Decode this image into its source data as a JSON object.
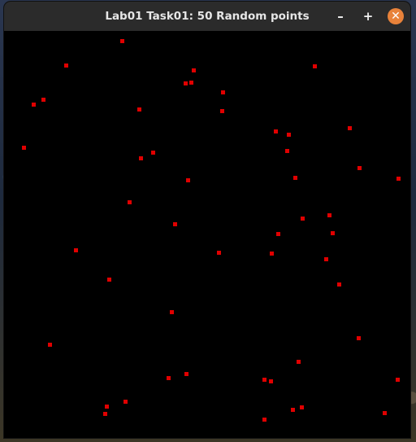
{
  "window": {
    "title": "Lab01 Task01: 50 Random points",
    "minimize_glyph": "–",
    "maximize_glyph": "+",
    "close_glyph": "✕"
  },
  "canvas": {
    "background": "#000000",
    "point_color": "#e00000",
    "point_count": 50
  },
  "icons": [
    "minimize-icon",
    "maximize-icon",
    "close-icon"
  ]
}
